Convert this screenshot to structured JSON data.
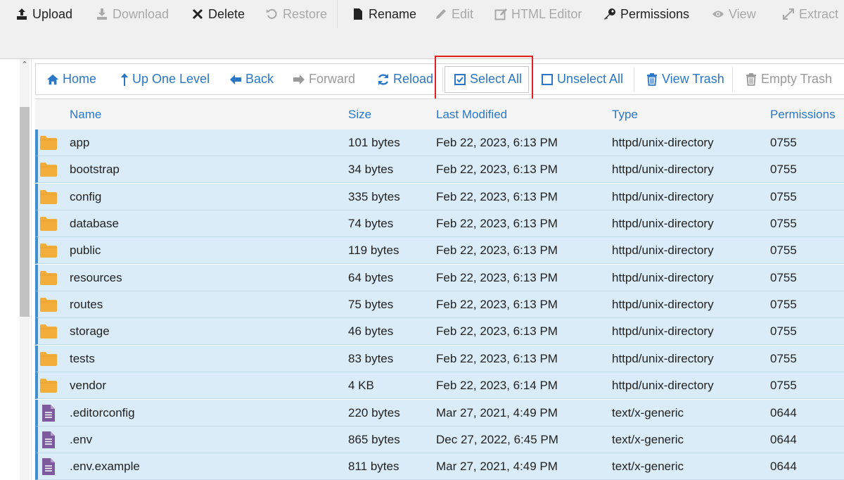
{
  "toolbar": {
    "buttons": [
      {
        "label": "Upload",
        "icon": "upload-icon",
        "enabled": true
      },
      {
        "label": "Download",
        "icon": "download-icon",
        "enabled": false
      },
      {
        "label": "Delete",
        "icon": "close-icon",
        "enabled": true
      },
      {
        "label": "Restore",
        "icon": "restore-icon",
        "enabled": false
      },
      {
        "label": "Rename",
        "icon": "file-icon",
        "enabled": true
      },
      {
        "label": "Edit",
        "icon": "pencil-icon",
        "enabled": false
      },
      {
        "label": "HTML Editor",
        "icon": "edit-square-icon",
        "enabled": false
      },
      {
        "label": "Permissions",
        "icon": "key-icon",
        "enabled": true
      },
      {
        "label": "View",
        "icon": "eye-icon",
        "enabled": false
      },
      {
        "label": "Extract",
        "icon": "expand-icon",
        "enabled": false
      }
    ]
  },
  "nav": {
    "buttons": [
      {
        "label": "Home",
        "icon": "home-icon",
        "enabled": true
      },
      {
        "label": "Up One Level",
        "icon": "arrow-up-icon",
        "enabled": true
      },
      {
        "label": "Back",
        "icon": "arrow-left-icon",
        "enabled": true
      },
      {
        "label": "Forward",
        "icon": "arrow-right-icon",
        "enabled": false
      },
      {
        "label": "Reload",
        "icon": "reload-icon",
        "enabled": true
      },
      {
        "label": "Select All",
        "icon": "checkbox-checked-icon",
        "enabled": true
      },
      {
        "label": "Unselect All",
        "icon": "checkbox-empty-icon",
        "enabled": true
      },
      {
        "label": "View Trash",
        "icon": "trash-icon",
        "enabled": true
      },
      {
        "label": "Empty Trash",
        "icon": "trash-icon",
        "enabled": false
      }
    ]
  },
  "table": {
    "headers": {
      "name": "Name",
      "size": "Size",
      "modified": "Last Modified",
      "type": "Type",
      "permissions": "Permissions"
    },
    "rows": [
      {
        "kind": "folder",
        "name": "app",
        "size": "101 bytes",
        "modified": "Feb 22, 2023, 6:13 PM",
        "type": "httpd/unix-directory",
        "perms": "0755"
      },
      {
        "kind": "folder",
        "name": "bootstrap",
        "size": "34 bytes",
        "modified": "Feb 22, 2023, 6:13 PM",
        "type": "httpd/unix-directory",
        "perms": "0755"
      },
      {
        "kind": "folder",
        "name": "config",
        "size": "335 bytes",
        "modified": "Feb 22, 2023, 6:13 PM",
        "type": "httpd/unix-directory",
        "perms": "0755"
      },
      {
        "kind": "folder",
        "name": "database",
        "size": "74 bytes",
        "modified": "Feb 22, 2023, 6:13 PM",
        "type": "httpd/unix-directory",
        "perms": "0755"
      },
      {
        "kind": "folder",
        "name": "public",
        "size": "119 bytes",
        "modified": "Feb 22, 2023, 6:13 PM",
        "type": "httpd/unix-directory",
        "perms": "0755"
      },
      {
        "kind": "folder",
        "name": "resources",
        "size": "64 bytes",
        "modified": "Feb 22, 2023, 6:13 PM",
        "type": "httpd/unix-directory",
        "perms": "0755"
      },
      {
        "kind": "folder",
        "name": "routes",
        "size": "75 bytes",
        "modified": "Feb 22, 2023, 6:13 PM",
        "type": "httpd/unix-directory",
        "perms": "0755"
      },
      {
        "kind": "folder",
        "name": "storage",
        "size": "46 bytes",
        "modified": "Feb 22, 2023, 6:13 PM",
        "type": "httpd/unix-directory",
        "perms": "0755"
      },
      {
        "kind": "folder",
        "name": "tests",
        "size": "83 bytes",
        "modified": "Feb 22, 2023, 6:13 PM",
        "type": "httpd/unix-directory",
        "perms": "0755"
      },
      {
        "kind": "folder",
        "name": "vendor",
        "size": "4 KB",
        "modified": "Feb 22, 2023, 6:14 PM",
        "type": "httpd/unix-directory",
        "perms": "0755"
      },
      {
        "kind": "file",
        "name": ".editorconfig",
        "size": "220 bytes",
        "modified": "Mar 27, 2021, 4:49 PM",
        "type": "text/x-generic",
        "perms": "0644"
      },
      {
        "kind": "file",
        "name": ".env",
        "size": "865 bytes",
        "modified": "Dec 27, 2022, 6:45 PM",
        "type": "text/x-generic",
        "perms": "0644"
      },
      {
        "kind": "file",
        "name": ".env.example",
        "size": "811 bytes",
        "modified": "Mar 27, 2021, 4:49 PM",
        "type": "text/x-generic",
        "perms": "0644"
      }
    ]
  },
  "colors": {
    "link": "#2a77c7",
    "row_selected": "#d9ecf8",
    "folder": "#f3ad3a",
    "file": "#7d5a9e",
    "highlight": "#e02020"
  }
}
